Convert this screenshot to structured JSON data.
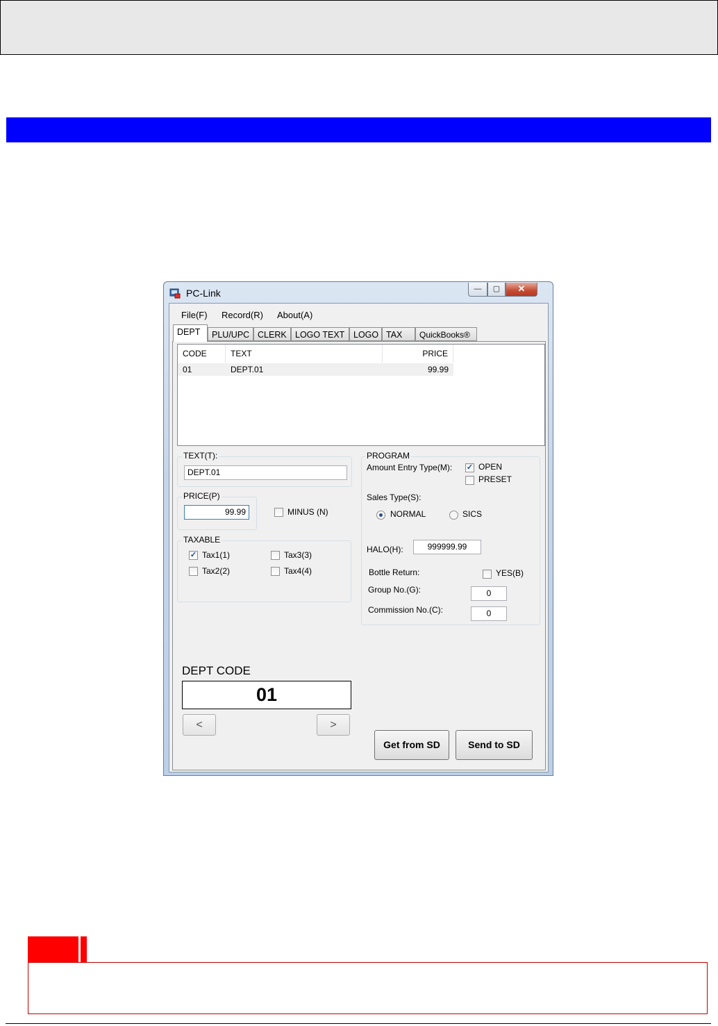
{
  "window": {
    "title": "PC-Link",
    "min_glyph": "—",
    "max_glyph": "▢",
    "close_glyph": "✕"
  },
  "menu": [
    {
      "label": "File(F)"
    },
    {
      "label": "Record(R)"
    },
    {
      "label": "About(A)"
    }
  ],
  "tabs": [
    {
      "label": "DEPT",
      "active": true
    },
    {
      "label": "PLU/UPC"
    },
    {
      "label": "CLERK"
    },
    {
      "label": "LOGO TEXT"
    },
    {
      "label": "LOGO"
    },
    {
      "label": "TAX"
    },
    {
      "label": "QuickBooks®"
    }
  ],
  "list": {
    "columns": [
      "CODE",
      "TEXT",
      "PRICE"
    ],
    "rows": [
      {
        "code": "01",
        "text": "DEPT.01",
        "price": "99.99"
      }
    ]
  },
  "text_group": {
    "label": "TEXT(T):",
    "value": "DEPT.01"
  },
  "price_group": {
    "label": "PRICE(P)",
    "value": "99.99",
    "minus_label": "MINUS (N)",
    "minus_checked": false
  },
  "taxable_group": {
    "label": "TAXABLE",
    "items": [
      {
        "label": "Tax1(1)",
        "checked": true
      },
      {
        "label": "Tax3(3)",
        "checked": false
      },
      {
        "label": "Tax2(2)",
        "checked": false
      },
      {
        "label": "Tax4(4)",
        "checked": false
      }
    ]
  },
  "program_group": {
    "label": "PROGRAM",
    "amount_entry_label": "Amount Entry Type(M):",
    "open_label": "OPEN",
    "open_checked": true,
    "preset_label": "PRESET",
    "preset_checked": false,
    "sales_type_label": "Sales Type(S):",
    "normal_label": "NORMAL",
    "sics_label": "SICS",
    "selected_sales_type": "NORMAL",
    "halo_label": "HALO(H):",
    "halo_value": "999999.99",
    "bottle_return_label": "Bottle Return:",
    "yes_label": "YES(B)",
    "yes_checked": false,
    "group_no_label": "Group No.(G):",
    "group_no_value": "0",
    "commission_no_label": "Commission No.(C):",
    "commission_no_value": "0"
  },
  "dept_code": {
    "label": "DEPT CODE",
    "value": "01",
    "prev_glyph": "<",
    "next_glyph": ">"
  },
  "buttons": {
    "get_from_sd": "Get from SD",
    "send_to_sd": "Send to SD"
  },
  "check_glyph": "✓"
}
